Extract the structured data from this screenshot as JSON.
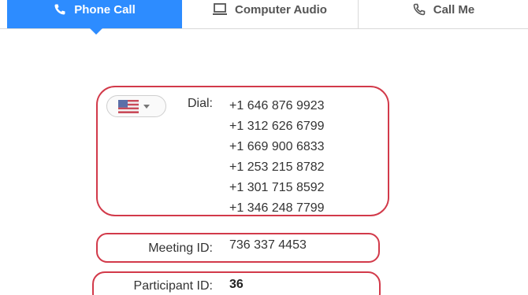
{
  "tabs": [
    {
      "label": "Phone Call",
      "icon": "phone-icon",
      "selected": true
    },
    {
      "label": "Computer Audio",
      "icon": "monitor-icon",
      "selected": false
    },
    {
      "label": "Call Me",
      "icon": "phone-icon",
      "selected": false
    }
  ],
  "dial": {
    "country_flag": "us-flag-icon",
    "label": "Dial:",
    "numbers": [
      "+1 646 876 9923",
      "+1 312 626 6799",
      "+1 669 900 6833",
      "+1 253 215 8782",
      "+1 301 715 8592",
      "+1 346 248 7799"
    ]
  },
  "meeting": {
    "label": "Meeting ID:",
    "value": "736 337 4453"
  },
  "participant": {
    "label": "Participant ID:",
    "value": "36"
  },
  "colors": {
    "accent": "#2d8cff",
    "highlight_border": "#d23a4a"
  }
}
